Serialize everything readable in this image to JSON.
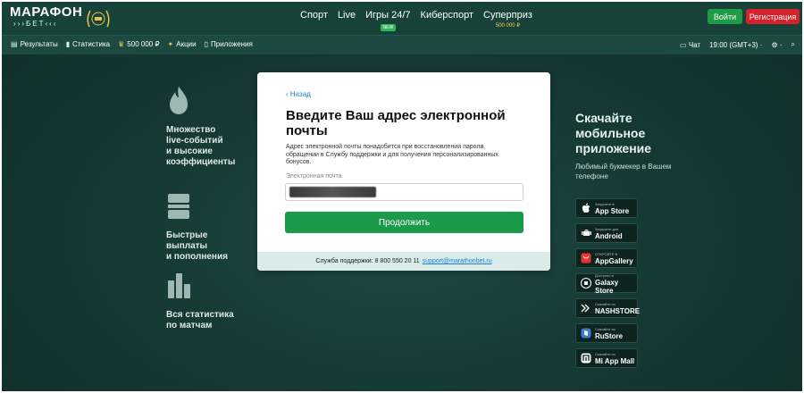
{
  "header": {
    "logo_line1": "МАРАФОН",
    "logo_line2": "БЕТ",
    "nav": [
      {
        "label": "Спорт",
        "sub": ""
      },
      {
        "label": "Live",
        "sub": ""
      },
      {
        "label": "Игры 24/7",
        "badge": "NEW"
      },
      {
        "label": "Киберспорт",
        "sub": ""
      },
      {
        "label": "Суперприз",
        "sub": "500 000 ₽"
      }
    ],
    "login_label": "Войти",
    "register_label": "Регистрация"
  },
  "subbar": {
    "links": [
      "Результаты",
      "Статистика",
      "500 000 ₽",
      "Акции",
      "Приложения"
    ],
    "chat": "Чат",
    "time": "19:00 (GMT+3) ·"
  },
  "features": [
    {
      "text": "Множество\nlive-событий\nи высокие\nкоэффициенты"
    },
    {
      "text": "Быстрые\nвыплаты\nи пополнения"
    },
    {
      "text": "Вся статистика\nпо матчам"
    }
  ],
  "modal": {
    "back": "‹ Назад",
    "title": "Введите Ваш адрес электронной почты",
    "description": "Адрес электронной почты понадобится при восстановлении пароля, обращении в Службу поддержки и для получения персонализированных бонусов.",
    "field_label": "Электронная почта",
    "email_value": "",
    "continue_label": "Продолжить",
    "support_text": "Служба поддержки: 8 800 550 20 11",
    "support_email": "support@marathonbet.ru"
  },
  "apps": {
    "title": "Скачайте мобильное приложение",
    "subtitle": "Любимый букмекер в Вашем телефоне",
    "stores": [
      {
        "small": "Загрузите в",
        "big": "App Store",
        "icon": "apple-icon"
      },
      {
        "small": "Загрузите для",
        "big": "Android",
        "icon": "android-icon"
      },
      {
        "small": "ОТКРОЙТЕ В",
        "big": "AppGallery",
        "icon": "huawei-icon"
      },
      {
        "small": "Доступно в",
        "big": "Galaxy Store",
        "icon": "galaxy-icon"
      },
      {
        "small": "Скачайте из",
        "big": "NASHSTORE",
        "icon": "nashstore-icon"
      },
      {
        "small": "Скачайте из",
        "big": "RuStore",
        "icon": "rustore-icon"
      },
      {
        "small": "Скачайте из",
        "big": "Mi App Mall",
        "icon": "mi-icon"
      }
    ]
  },
  "colors": {
    "accent_green": "#1a9a4a",
    "register_red": "#d8222b",
    "header_bg": "#164239",
    "link_blue": "#1a7fd0"
  }
}
